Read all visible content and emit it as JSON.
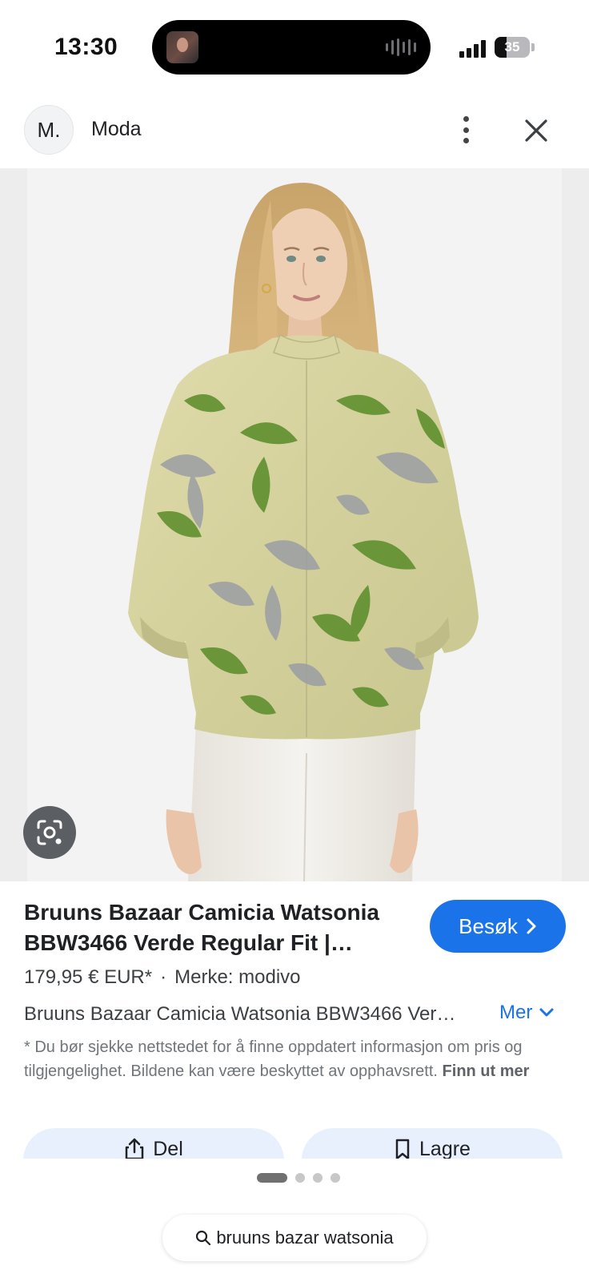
{
  "status_bar": {
    "time": "13:30",
    "battery_level": "35"
  },
  "header": {
    "source_initial": "M.",
    "source_name": "Moda"
  },
  "product": {
    "title": "Bruuns Bazaar Camicia Watsonia BBW3466 Verde Regular Fit |…",
    "visit_label": "Besøk",
    "price": "179,95 € EUR*",
    "separator": "·",
    "brand": "Merke: modivo",
    "description": "Bruuns Bazaar Camicia Watsonia BBW3466 Ver…",
    "more_label": "Mer",
    "disclaimer": "* Du bør sjekke nettstedet for å finne oppdatert informasjon om pris og tilgjengelighet. Bildene kan være beskyttet av opphavsrett.",
    "disclaimer_link": "Finn ut mer"
  },
  "actions": {
    "share_label": "Del",
    "save_label": "Lagre"
  },
  "pager": {
    "current_page": 1,
    "total_pages": 4
  },
  "search": {
    "query": "bruuns bazar watsonia"
  },
  "colors": {
    "accent": "#1a73e8",
    "action_bg": "#e8f0fe",
    "blouse_base": "#d9d6a6",
    "blouse_green": "#5f8f2e",
    "blouse_gray": "#9a9ea3",
    "pants": "#efece6",
    "hair": "#d6b27a"
  },
  "icons": [
    "image-thumbnail",
    "sound-wave-icon",
    "signal-icon",
    "battery-icon",
    "more-vert-icon",
    "close-icon",
    "lens-icon",
    "chevron-right-icon",
    "chevron-down-icon",
    "share-icon",
    "bookmark-icon",
    "search-icon"
  ]
}
